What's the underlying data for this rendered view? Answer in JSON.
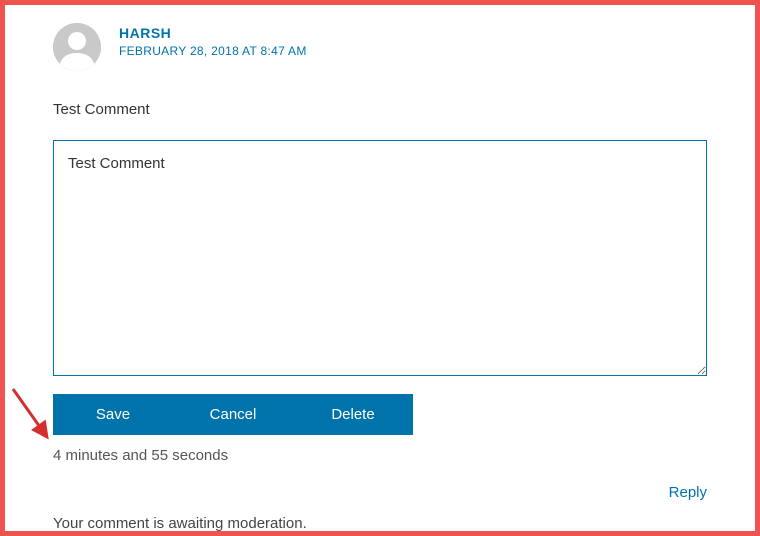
{
  "comment": {
    "author_name": "HARSH",
    "date_text": "FEBRUARY 28, 2018 AT 8:47 AM",
    "body_text": "Test Comment",
    "edit_value": "Test Comment",
    "timer_text": "4 minutes and 55 seconds",
    "moderation_text": "Your comment is awaiting moderation."
  },
  "buttons": {
    "save": "Save",
    "cancel": "Cancel",
    "delete": "Delete",
    "reply": "Reply"
  }
}
